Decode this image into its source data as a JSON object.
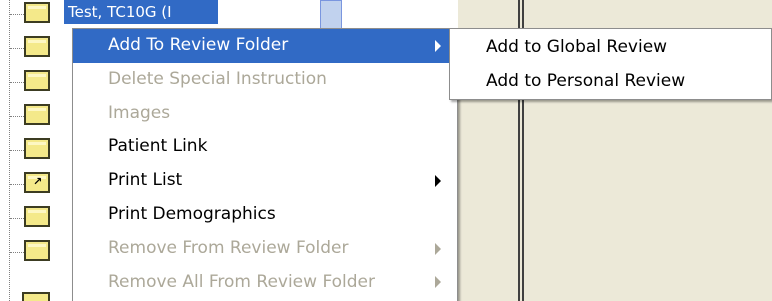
{
  "tree": {
    "selected_label": "Test, TC10G (I",
    "folder_icons": [
      "folder-icon",
      "folder-icon",
      "folder-icon",
      "folder-icon",
      "folder-icon",
      "folder-shortcut-icon",
      "folder-icon",
      "folder-icon"
    ]
  },
  "context_menu": {
    "items": [
      {
        "label": "Add To Review Folder",
        "state": "highlighted",
        "submenu": true
      },
      {
        "label": "Delete Special Instruction",
        "state": "disabled",
        "submenu": false
      },
      {
        "label": "Images",
        "state": "disabled",
        "submenu": false
      },
      {
        "label": "Patient Link",
        "state": "enabled",
        "submenu": false
      },
      {
        "label": "Print List",
        "state": "enabled",
        "submenu": true
      },
      {
        "label": "Print Demographics",
        "state": "enabled",
        "submenu": false
      },
      {
        "label": "Remove From Review Folder",
        "state": "disabled",
        "submenu": true
      },
      {
        "label": "Remove All From Review Folder",
        "state": "disabled",
        "submenu": true
      }
    ]
  },
  "submenu": {
    "items": [
      {
        "label": "Add to Global Review"
      },
      {
        "label": "Add to Personal Review"
      }
    ]
  },
  "colors": {
    "highlight": "#316ac5",
    "disabled_text": "#aca899",
    "folder_fill": "#f4e98a"
  }
}
